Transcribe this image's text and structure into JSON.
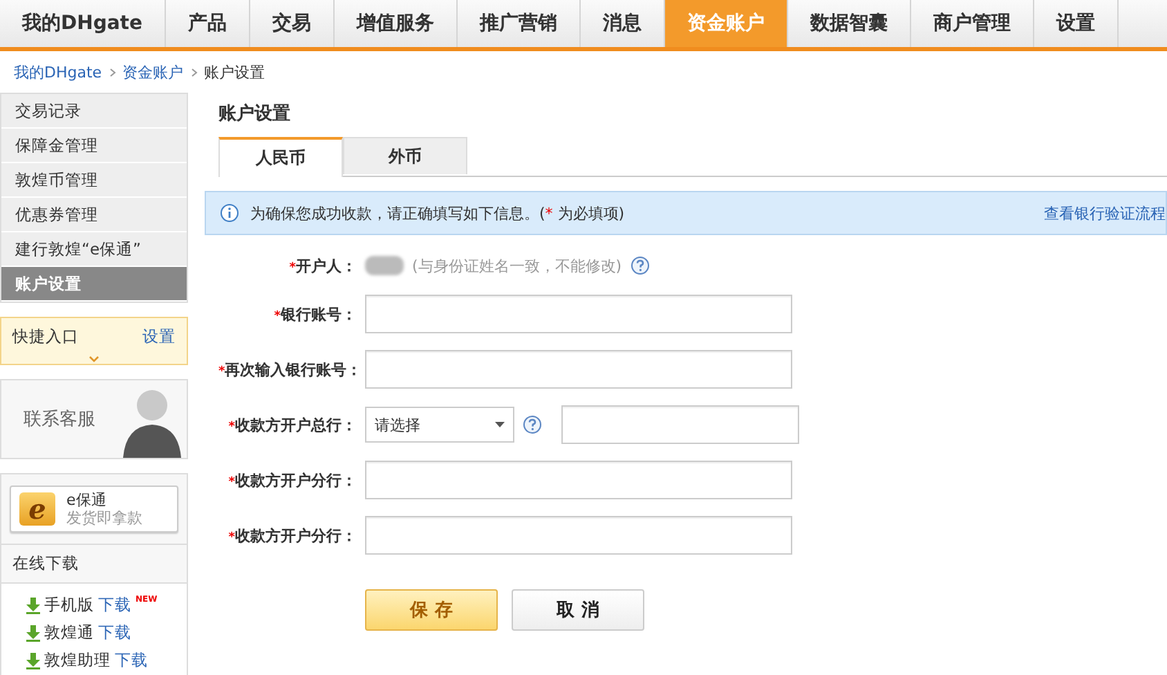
{
  "nav": [
    {
      "label": "我的DHgate",
      "selected": false
    },
    {
      "label": "产品",
      "selected": false
    },
    {
      "label": "交易",
      "selected": false
    },
    {
      "label": "增值服务",
      "selected": false
    },
    {
      "label": "推广营销",
      "selected": false
    },
    {
      "label": "消息",
      "selected": false
    },
    {
      "label": "资金账户",
      "selected": true
    },
    {
      "label": "数据智囊",
      "selected": false
    },
    {
      "label": "商户管理",
      "selected": false
    },
    {
      "label": "设置",
      "selected": false
    }
  ],
  "breadcrumb": {
    "links": [
      "我的DHgate",
      "资金账户"
    ],
    "current": "账户设置"
  },
  "sidebar": {
    "items": [
      {
        "label": "交易记录",
        "selected": false
      },
      {
        "label": "保障金管理",
        "selected": false
      },
      {
        "label": "敦煌币管理",
        "selected": false
      },
      {
        "label": "优惠券管理",
        "selected": false
      },
      {
        "label": "建行敦煌“e保通”",
        "selected": false
      },
      {
        "label": "账户设置",
        "selected": true
      }
    ],
    "quick_entry": {
      "title": "快捷入口",
      "link": "设置"
    },
    "contact": {
      "label": "联系客服"
    },
    "epay": {
      "logo": "e",
      "title": "e保通",
      "subtitle": "发货即拿款"
    },
    "downloads": {
      "title": "在线下载",
      "items": [
        {
          "name": "手机版",
          "link": "下载",
          "badge": "NEW"
        },
        {
          "name": "敦煌通",
          "link": "下载"
        },
        {
          "name": "敦煌助理",
          "link": "下载"
        }
      ]
    }
  },
  "main": {
    "title": "账户设置",
    "tabs": [
      {
        "label": "人民币",
        "selected": true
      },
      {
        "label": "外币",
        "selected": false
      }
    ],
    "notice": {
      "before": "为确保您成功收款，请正确填写如下信息。(",
      "mark": "*",
      "after": " 为必填项)",
      "link": "查看银行验证流程"
    },
    "fields": [
      {
        "kind": "static",
        "label": "开户人：",
        "required": true,
        "hint": "(与身份证姓名一致，不能修改)"
      },
      {
        "kind": "text",
        "label": "银行账号：",
        "required": true
      },
      {
        "kind": "text",
        "label": "再次输入银行账号：",
        "required": true
      },
      {
        "kind": "select",
        "label": "收款方开户总行：",
        "required": true,
        "value": "请选择"
      },
      {
        "kind": "text",
        "label": "收款方开户分行：",
        "required": true
      },
      {
        "kind": "text",
        "label": "收款方开户分行：",
        "required": true
      }
    ],
    "buttons": [
      {
        "label": "保 存",
        "kind": "primary"
      },
      {
        "label": "取 消",
        "kind": "secondary"
      }
    ]
  }
}
